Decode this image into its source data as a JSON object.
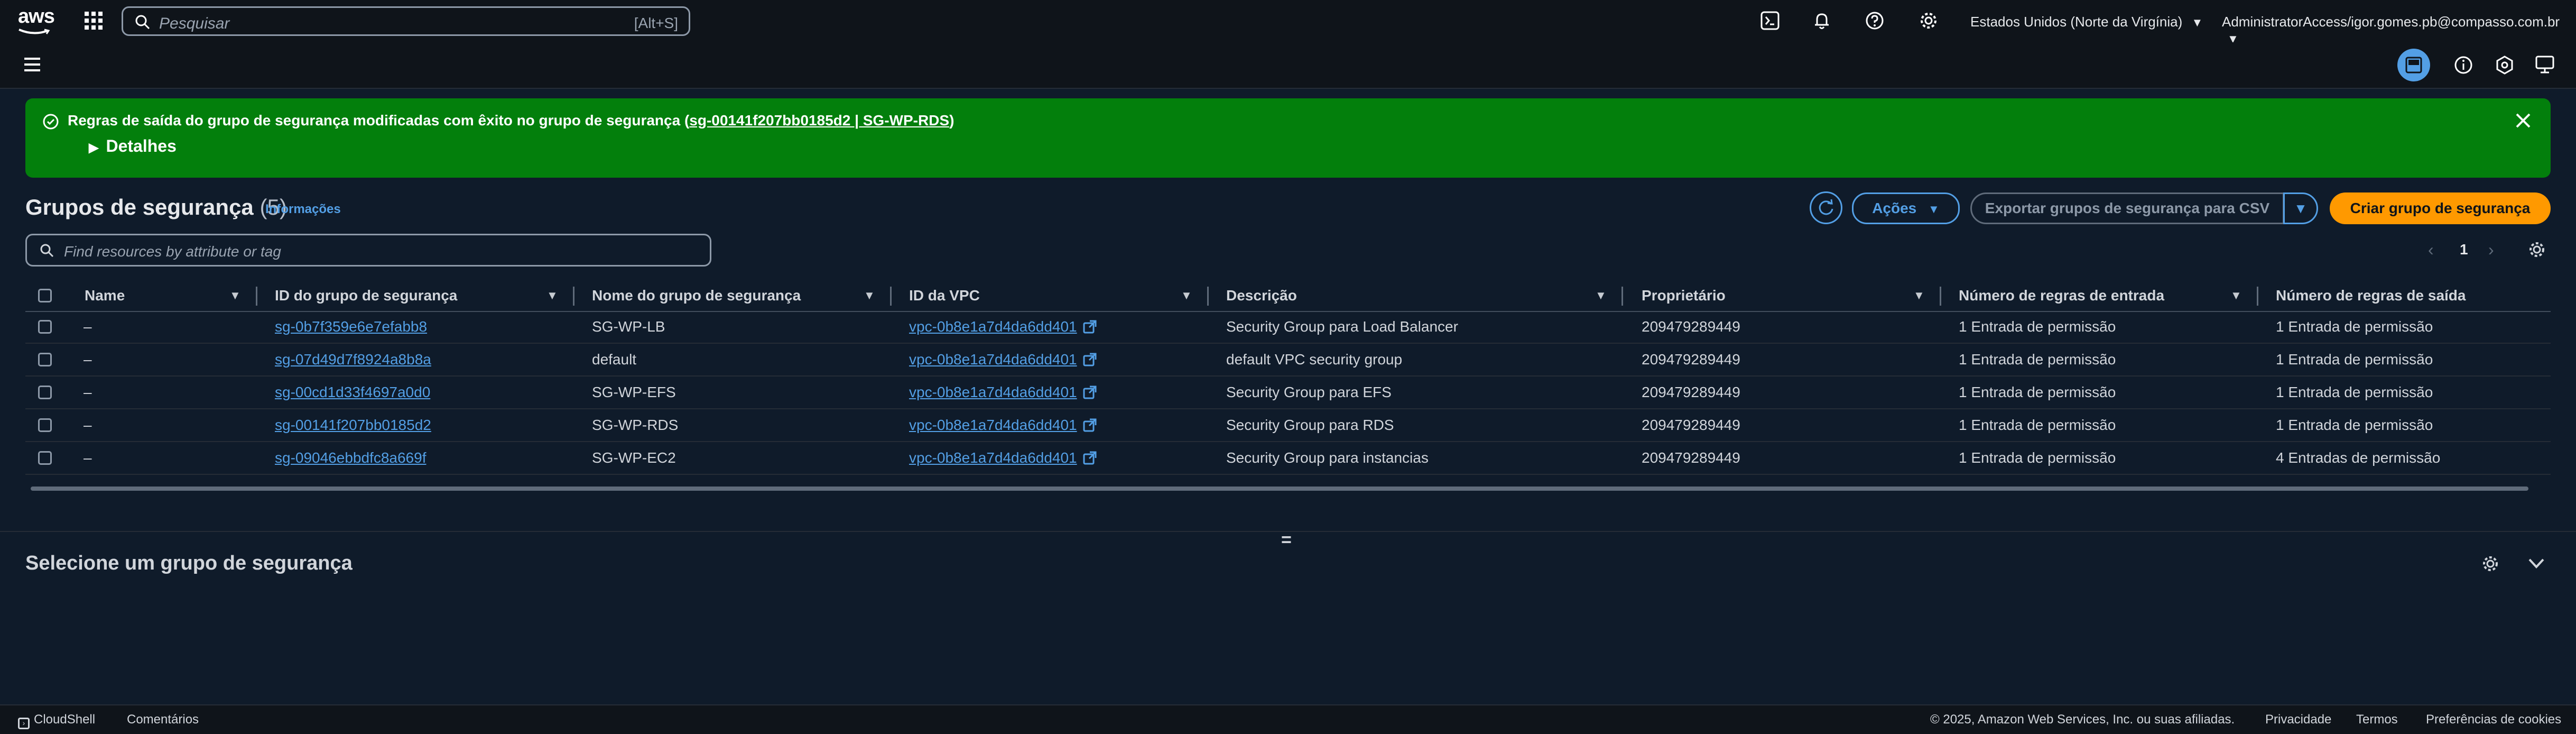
{
  "topbar": {
    "logo": "aws",
    "search_placeholder": "Pesquisar",
    "search_shortcut": "[Alt+S]",
    "region": "Estados Unidos (Norte da Virgínia)",
    "account": "AdministratorAccess/igor.gomes.pb@compasso.com.br"
  },
  "flash": {
    "message_prefix": "Regras de saída do grupo de segurança modificadas com êxito no grupo de segurança (",
    "message_link": "sg-00141f207bb0185d2 | SG-WP-RDS",
    "message_suffix": ")",
    "details": "Detalhes",
    "color": "#037f0c"
  },
  "header": {
    "title": "Grupos de segurança",
    "count": "(5)",
    "info": "Informações",
    "actions_label": "Ações",
    "export_label": "Exportar grupos de segurança para CSV",
    "create_label": "Criar grupo de segurança",
    "accent": "#ff9900"
  },
  "filter": {
    "placeholder": "Find resources by attribute or tag"
  },
  "pagination": {
    "page": "1"
  },
  "table": {
    "columns": [
      "Name",
      "ID do grupo de segurança",
      "Nome do grupo de segurança",
      "ID da VPC",
      "Descrição",
      "Proprietário",
      "Número de regras de entrada",
      "Número de regras de saída"
    ],
    "rows": [
      {
        "name": "–",
        "sg_id": "sg-0b7f359e6e7efabb8",
        "sg_name": "SG-WP-LB",
        "vpc": "vpc-0b8e1a7d4da6dd401",
        "desc": "Security Group para Load Balancer",
        "owner": "209479289449",
        "in": "1 Entrada de permissão",
        "out": "1 Entrada de permissão"
      },
      {
        "name": "–",
        "sg_id": "sg-07d49d7f8924a8b8a",
        "sg_name": "default",
        "vpc": "vpc-0b8e1a7d4da6dd401",
        "desc": "default VPC security group",
        "owner": "209479289449",
        "in": "1 Entrada de permissão",
        "out": "1 Entrada de permissão"
      },
      {
        "name": "–",
        "sg_id": "sg-00cd1d33f4697a0d0",
        "sg_name": "SG-WP-EFS",
        "vpc": "vpc-0b8e1a7d4da6dd401",
        "desc": "Security Group para EFS",
        "owner": "209479289449",
        "in": "1 Entrada de permissão",
        "out": "1 Entrada de permissão"
      },
      {
        "name": "–",
        "sg_id": "sg-00141f207bb0185d2",
        "sg_name": "SG-WP-RDS",
        "vpc": "vpc-0b8e1a7d4da6dd401",
        "desc": "Security Group para RDS",
        "owner": "209479289449",
        "in": "1 Entrada de permissão",
        "out": "1 Entrada de permissão"
      },
      {
        "name": "–",
        "sg_id": "sg-09046ebbdfc8a669f",
        "sg_name": "SG-WP-EC2",
        "vpc": "vpc-0b8e1a7d4da6dd401",
        "desc": "Security Group para instancias",
        "owner": "209479289449",
        "in": "1 Entrada de permissão",
        "out": "4 Entradas de permissão"
      }
    ]
  },
  "split_handle": "=",
  "details_panel": {
    "title": "Selecione um grupo de segurança"
  },
  "footer": {
    "cloudshell": "CloudShell",
    "feedback": "Comentários",
    "copyright": "© 2025, Amazon Web Services, Inc. ou suas afiliadas.",
    "privacy": "Privacidade",
    "terms": "Termos",
    "cookies": "Preferências de cookies"
  }
}
